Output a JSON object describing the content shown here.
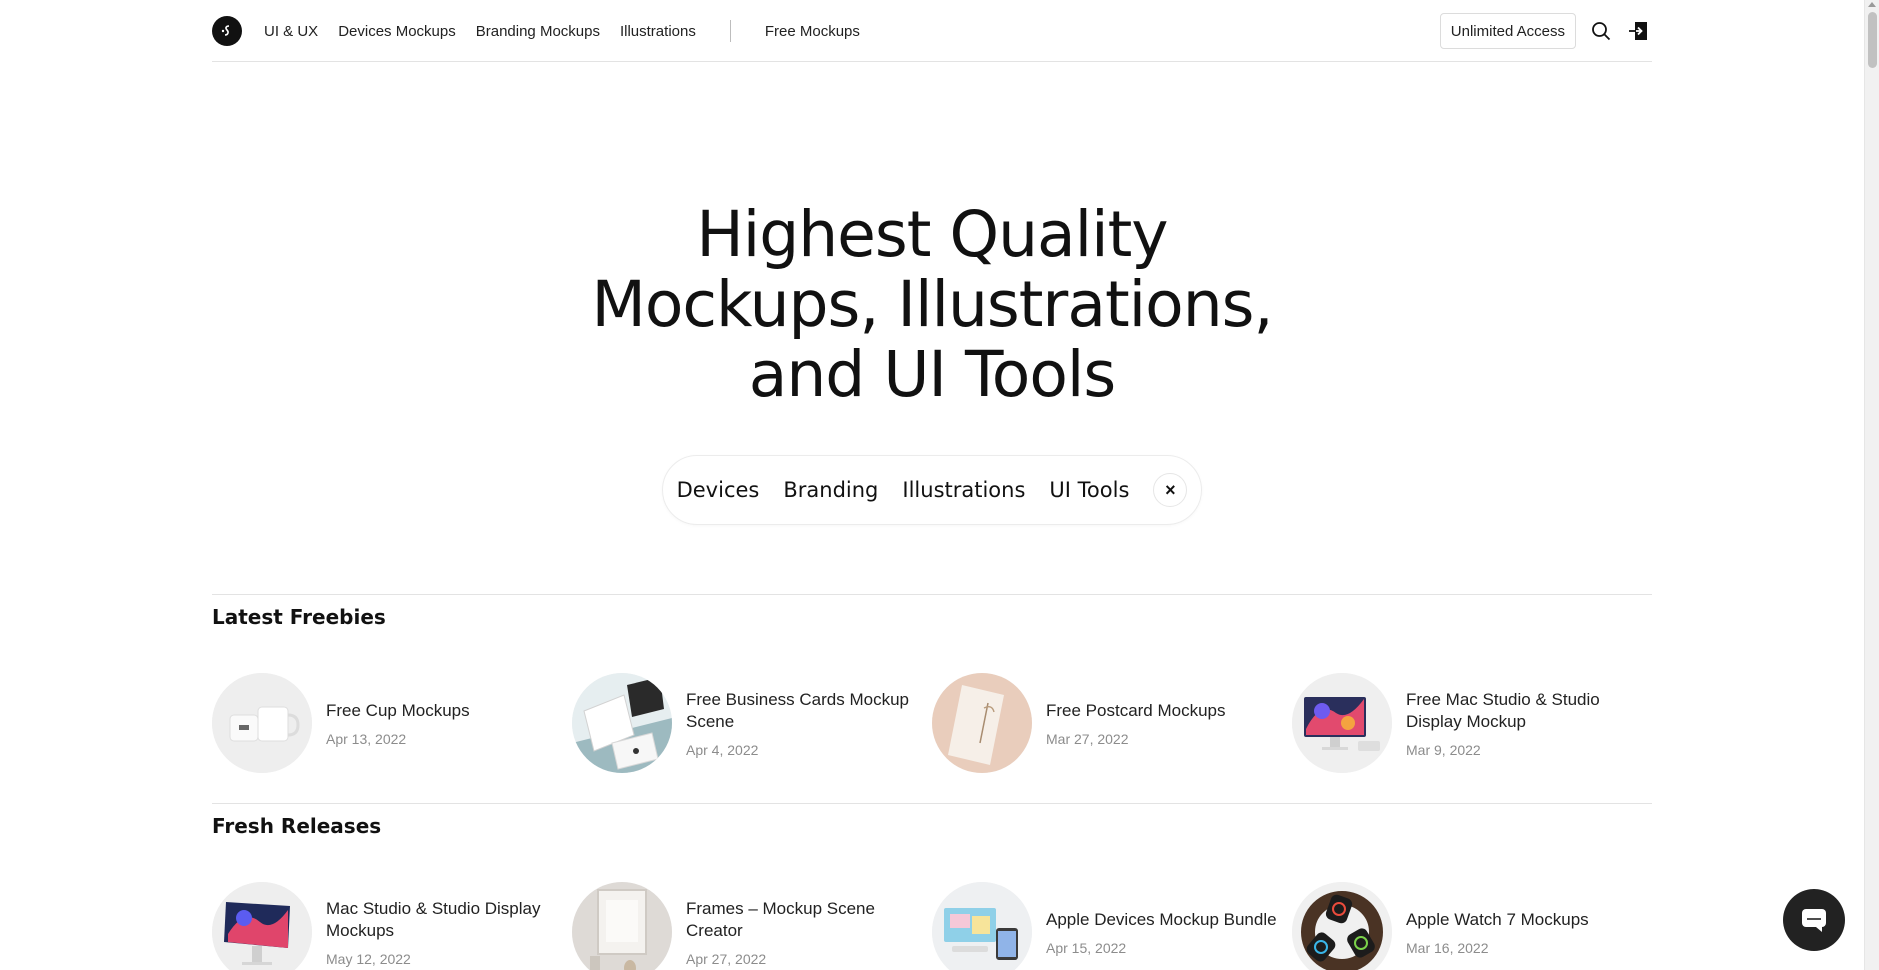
{
  "header": {
    "nav_items": [
      "UI & UX",
      "Devices Mockups",
      "Branding Mockups",
      "Illustrations"
    ],
    "free_mockups": "Free Mockups",
    "unlimited_access": "Unlimited Access",
    "icons": [
      "logo",
      "search-icon",
      "login-icon"
    ]
  },
  "hero": {
    "title_line1": "Highest Quality",
    "title_line2": "Mockups, Illustrations,",
    "title_line3": "and UI Tools"
  },
  "filters": {
    "items": [
      "Devices",
      "Branding",
      "Illustrations",
      "UI Tools"
    ],
    "close": "×"
  },
  "latest": {
    "title": "Latest Freebies",
    "items": [
      {
        "title": "Free Cup Mockups",
        "date": "Apr 13, 2022"
      },
      {
        "title": "Free Business Cards Mockup Scene",
        "date": "Apr 4, 2022"
      },
      {
        "title": "Free Postcard Mockups",
        "date": "Mar 27, 2022"
      },
      {
        "title": "Free Mac Studio & Studio Display Mockup",
        "date": "Mar 9, 2022"
      }
    ]
  },
  "fresh": {
    "title": "Fresh Releases",
    "items": [
      {
        "title": "Mac Studio & Studio Display Mockups",
        "date": "May 12, 2022"
      },
      {
        "title": "Frames – Mockup Scene Creator",
        "date": "Apr 27, 2022"
      },
      {
        "title": "Apple Devices Mockup Bundle",
        "date": "Apr 15, 2022"
      },
      {
        "title": "Apple Watch 7 Mockups",
        "date": "Mar 16, 2022"
      }
    ]
  }
}
